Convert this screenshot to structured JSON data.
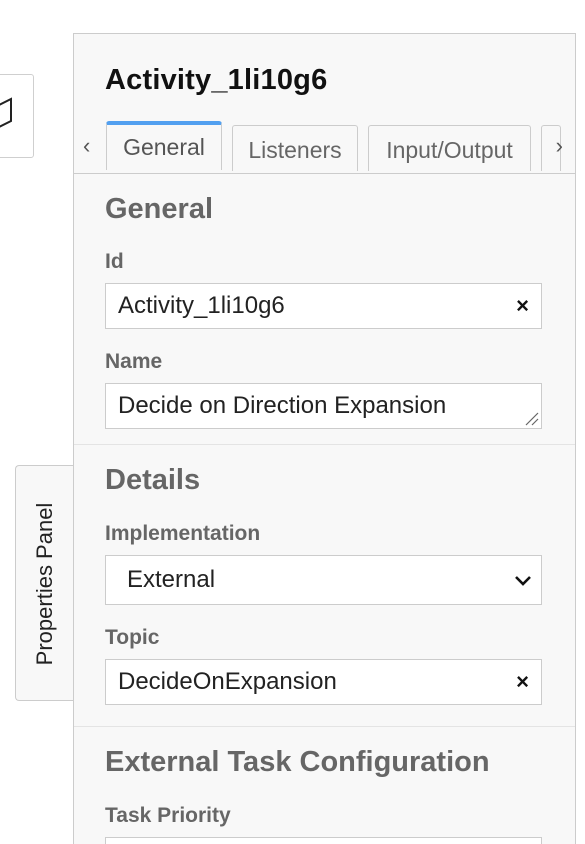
{
  "panel": {
    "title": "Activity_1li10g6",
    "side_tab_label": "Properties Panel"
  },
  "tabs": [
    {
      "label": "General",
      "active": true
    },
    {
      "label": "Listeners",
      "active": false
    },
    {
      "label": "Input/Output",
      "active": false
    }
  ],
  "tab_nav": {
    "left": "‹",
    "right": "›"
  },
  "general": {
    "title": "General",
    "id_label": "Id",
    "id_value": "Activity_1li10g6",
    "name_label": "Name",
    "name_value": "Decide on Direction Expansion"
  },
  "details": {
    "title": "Details",
    "implementation_label": "Implementation",
    "implementation_value": "External",
    "topic_label": "Topic",
    "topic_value": "DecideOnExpansion"
  },
  "external": {
    "title": "External Task Configuration",
    "priority_label": "Task Priority"
  },
  "icons": {
    "clear": "×"
  },
  "colors": {
    "accent": "#52a0f0",
    "panel_bg": "#f8f8f8",
    "border": "#cccccc"
  }
}
